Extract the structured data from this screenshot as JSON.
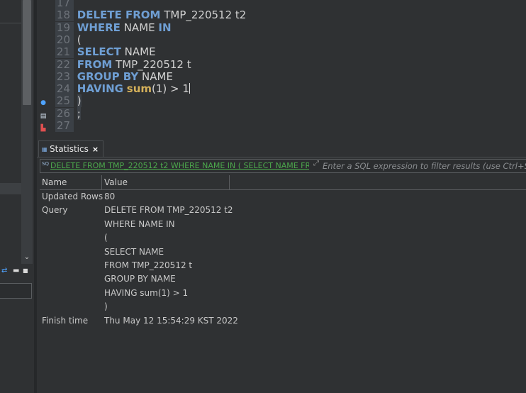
{
  "editor": {
    "lines": [
      {
        "num": "17",
        "parts": []
      },
      {
        "num": "18",
        "parts": [
          {
            "t": "DELETE FROM",
            "c": "kw"
          },
          {
            "t": " TMP_220512 t2",
            "c": "tx"
          }
        ]
      },
      {
        "num": "19",
        "parts": [
          {
            "t": "WHERE",
            "c": "kw"
          },
          {
            "t": " NAME ",
            "c": "tx"
          },
          {
            "t": "IN",
            "c": "kw"
          }
        ]
      },
      {
        "num": "20",
        "parts": [
          {
            "t": "(",
            "c": "tx"
          }
        ]
      },
      {
        "num": "21",
        "parts": [
          {
            "t": "SELECT",
            "c": "kw"
          },
          {
            "t": " NAME",
            "c": "tx"
          }
        ]
      },
      {
        "num": "22",
        "parts": [
          {
            "t": "FROM",
            "c": "kw"
          },
          {
            "t": " TMP_220512 t",
            "c": "tx"
          }
        ]
      },
      {
        "num": "23",
        "parts": [
          {
            "t": "GROUP BY",
            "c": "kw"
          },
          {
            "t": " NAME",
            "c": "tx"
          }
        ]
      },
      {
        "num": "24",
        "parts": [
          {
            "t": "HAVING",
            "c": "kw"
          },
          {
            "t": " ",
            "c": "tx"
          },
          {
            "t": "sum",
            "c": "fn"
          },
          {
            "t": "(1) > 1",
            "c": "tx"
          }
        ]
      },
      {
        "num": "25",
        "parts": [
          {
            "t": ")",
            "c": "tx"
          }
        ]
      },
      {
        "num": "26",
        "parts": [
          {
            "t": ";",
            "c": "tx"
          }
        ]
      },
      {
        "num": "27",
        "parts": []
      }
    ]
  },
  "results": {
    "tab_label": "Statistics",
    "tab_close": "×",
    "filter": {
      "query_text": "DELETE FROM TMP_220512 t2 WHERE NAME IN ( SELECT NAME FR",
      "placeholder": "Enter a SQL expression to filter results (use Ctrl+Space)"
    },
    "columns": [
      "Name",
      "Value"
    ],
    "rows": [
      {
        "name": "Updated Rows",
        "values": [
          "80"
        ]
      },
      {
        "name": "Query",
        "values": [
          "DELETE FROM TMP_220512 t2",
          "WHERE NAME IN",
          "(",
          "SELECT NAME",
          "FROM TMP_220512 t",
          "GROUP BY NAME",
          "HAVING sum(1) > 1",
          ")"
        ]
      },
      {
        "name": "Finish time",
        "values": [
          "Thu May 12 15:54:29 KST 2022"
        ]
      }
    ]
  },
  "icons": {
    "left_scroll_down": "chevron-down-icon",
    "tab": "grid-icon",
    "tab_close": "close-icon",
    "filter_sql": "sql-icon",
    "filter_expand": "expand-icon"
  },
  "colors": {
    "keyword": "#6f9fd4",
    "function": "#d4b05a",
    "filter_text": "#4ca84c"
  }
}
